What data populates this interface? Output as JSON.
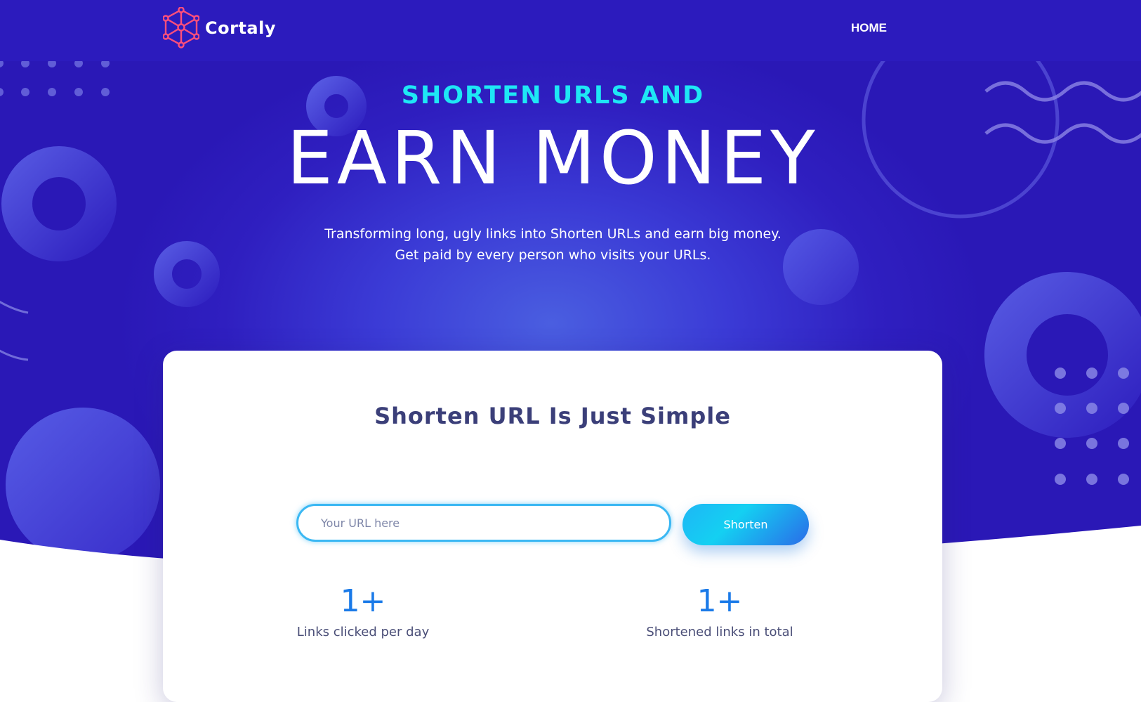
{
  "brand": {
    "name": "Cortaly",
    "accent": "#ff4f7b"
  },
  "nav": {
    "home_label": "HOME"
  },
  "hero": {
    "subtitle": "SHORTEN URLS AND",
    "headline": "EARN MONEY",
    "desc_line1": "Transforming long, ugly links into Shorten URLs and earn big money.",
    "desc_line2": "Get paid by every person who visits your URLs."
  },
  "card": {
    "title": "Shorten URL Is Just Simple",
    "input_placeholder": "Your URL here",
    "button_label": "Shorten"
  },
  "stats": [
    {
      "value": "1+",
      "label": "Links clicked per day"
    },
    {
      "value": "1+",
      "label": "Shortened links in total"
    }
  ],
  "colors": {
    "nav_bg": "#2c1bbd",
    "hero_cyan": "#1ee7f5",
    "stat_blue": "#1a7ae8"
  }
}
